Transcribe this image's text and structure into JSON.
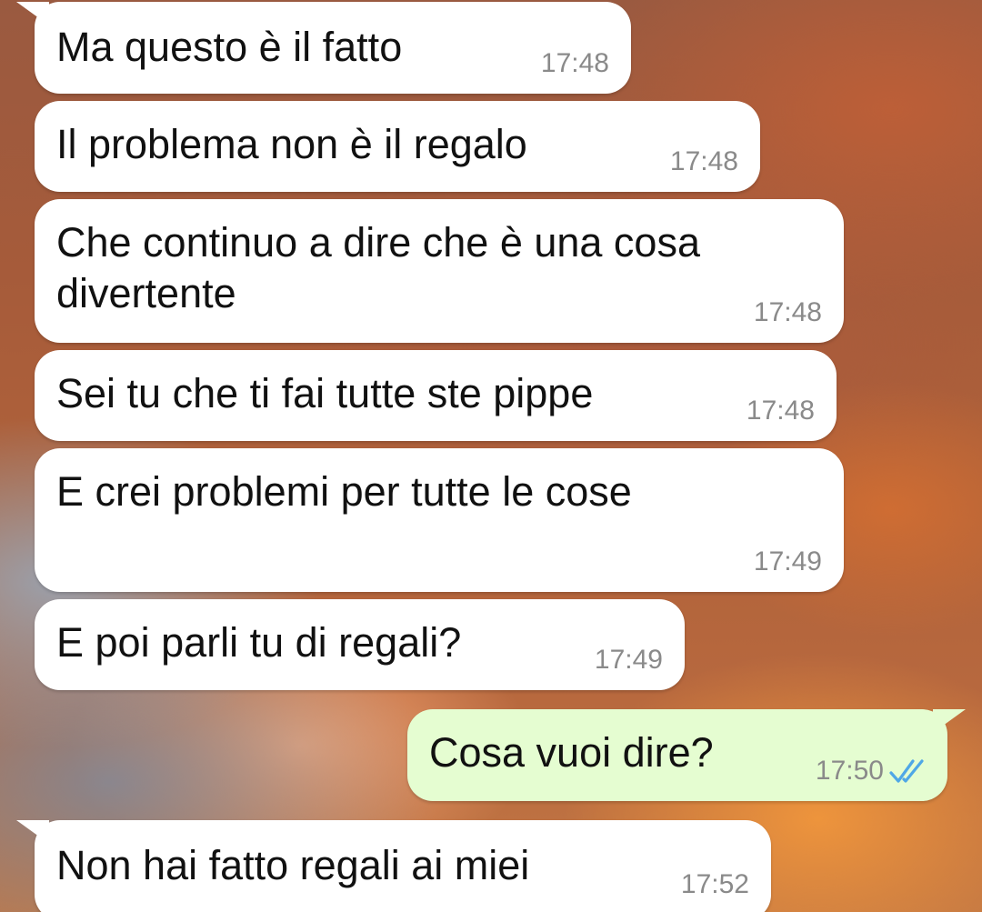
{
  "messages": [
    {
      "text": "Ma questo è il fatto",
      "time": "17:48",
      "direction": "in"
    },
    {
      "text": "Il problema non è il regalo",
      "time": "17:48",
      "direction": "in"
    },
    {
      "text": "Che continuo a dire che è una cosa\ndivertente",
      "time": "17:48",
      "direction": "in"
    },
    {
      "text": "Sei tu che ti fai tutte ste pippe",
      "time": "17:48",
      "direction": "in"
    },
    {
      "text": "E crei problemi per tutte le cose",
      "time": "17:49",
      "direction": "in"
    },
    {
      "text": "E poi parli tu di regali?",
      "time": "17:49",
      "direction": "in"
    },
    {
      "text": "Cosa vuoi dire?",
      "time": "17:50",
      "direction": "out",
      "status_icon": "double-check-read-icon"
    },
    {
      "text": "Non hai fatto regali ai miei",
      "time": "17:52",
      "direction": "in"
    }
  ],
  "colors": {
    "incoming_bubble": "#ffffff",
    "outgoing_bubble": "#e5fdd1",
    "read_ticks": "#4fa7e6",
    "timestamp": "#8a8a8a"
  }
}
